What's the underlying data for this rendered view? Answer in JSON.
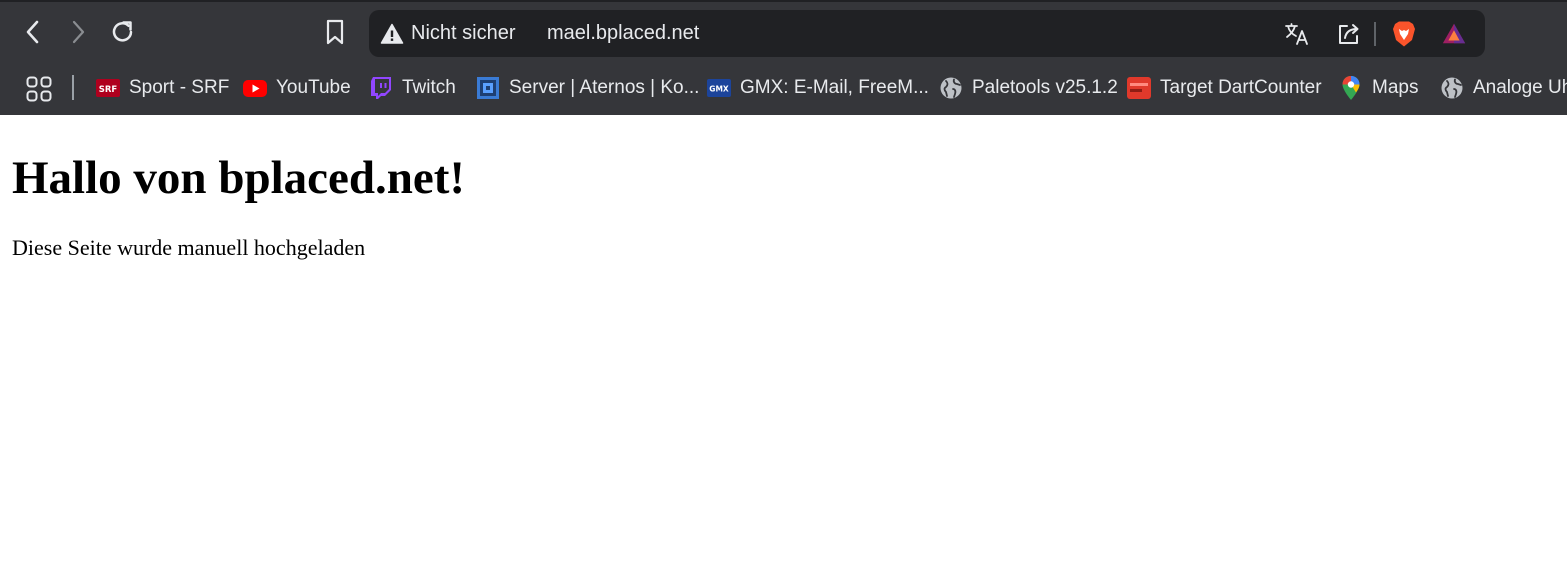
{
  "browser": {
    "address_bar": {
      "security_label": "Nicht sicher",
      "url": "mael.bplaced.net"
    },
    "icons": {
      "back": "chevron-left-icon",
      "forward": "chevron-right-icon",
      "reload": "reload-icon",
      "bookmark": "bookmark-icon",
      "security": "warning-triangle-icon",
      "translate": "translate-icon",
      "share": "share-icon",
      "brave": "brave-shields-icon",
      "rewards": "brave-rewards-icon",
      "apps": "apps-grid-icon"
    },
    "bookmarks": [
      {
        "label": "Sport - SRF",
        "icon": "srf-icon"
      },
      {
        "label": "YouTube",
        "icon": "youtube-icon"
      },
      {
        "label": "Twitch",
        "icon": "twitch-icon"
      },
      {
        "label": "Server | Aternos | Ko...",
        "icon": "aternos-icon"
      },
      {
        "label": "GMX: E-Mail, FreeM...",
        "icon": "gmx-icon"
      },
      {
        "label": "Paletools v25.1.2",
        "icon": "globe-icon"
      },
      {
        "label": "Target DartCounter",
        "icon": "dartcounter-icon"
      },
      {
        "label": "Maps",
        "icon": "maps-pin-icon"
      },
      {
        "label": "Analoge Uhr",
        "icon": "globe-icon"
      }
    ],
    "colors": {
      "toolbar": "#35363a",
      "omnibox": "#202124",
      "text": "#e8eaed"
    }
  },
  "page": {
    "heading": "Hallo von bplaced.net!",
    "paragraph": "Diese Seite wurde manuell hochgeladen"
  }
}
